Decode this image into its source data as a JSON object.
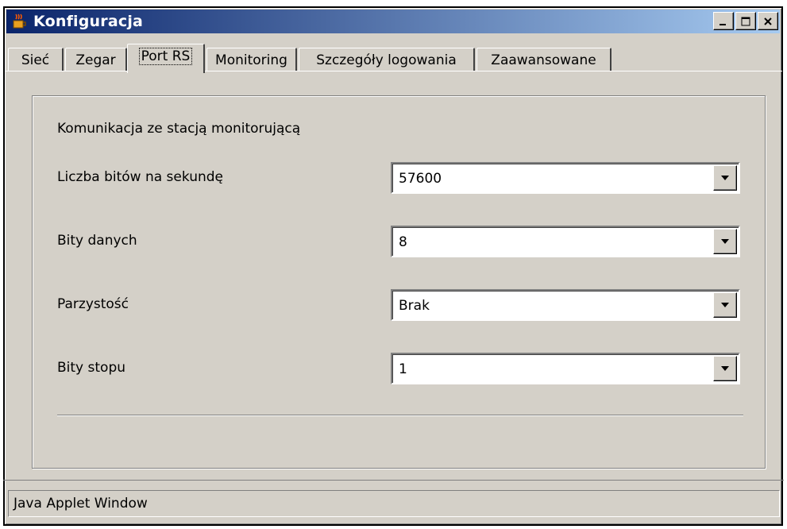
{
  "window": {
    "title": "Konfiguracja",
    "icon": "java-coffee-cup-icon",
    "controls": [
      "minimize-icon",
      "maximize-icon",
      "close-icon"
    ]
  },
  "tabs": [
    {
      "label": "Sieć",
      "active": false
    },
    {
      "label": "Zegar",
      "active": false
    },
    {
      "label": "Port RS",
      "active": true
    },
    {
      "label": "Monitoring",
      "active": false
    },
    {
      "label": "Szczegóły logowania",
      "active": false
    },
    {
      "label": "Zaawansowane",
      "active": false
    }
  ],
  "panel": {
    "section_title": "Komunikacja ze stacją monitorującą",
    "fields": [
      {
        "label": "Liczba bitów na sekundę",
        "value": "57600"
      },
      {
        "label": "Bity danych",
        "value": "8"
      },
      {
        "label": "Parzystość",
        "value": "Brak"
      },
      {
        "label": "Bity stopu",
        "value": "1"
      }
    ]
  },
  "status": {
    "text": "Java Applet Window"
  },
  "colors": {
    "titlebar_start": "#0a246a",
    "titlebar_end": "#a6caf0",
    "face": "#d4d0c8"
  }
}
